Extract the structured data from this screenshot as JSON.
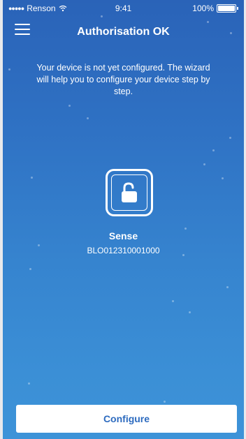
{
  "status_bar": {
    "carrier": "Renson",
    "time": "9:41",
    "battery": "100%"
  },
  "header": {
    "title": "Authorisation OK",
    "menu_icon": "hamburger-menu-icon"
  },
  "intro_text": "Your device is not yet configured. The wizard will help you to configure your device step by step.",
  "device": {
    "icon": "unlocked-padlock-icon",
    "name": "Sense",
    "serial": "BLO012310001000"
  },
  "actions": {
    "configure_label": "Configure"
  },
  "colors": {
    "background_top": "#2a63b8",
    "background_bottom": "#3d93d8",
    "button_text": "#2d6bbf"
  }
}
